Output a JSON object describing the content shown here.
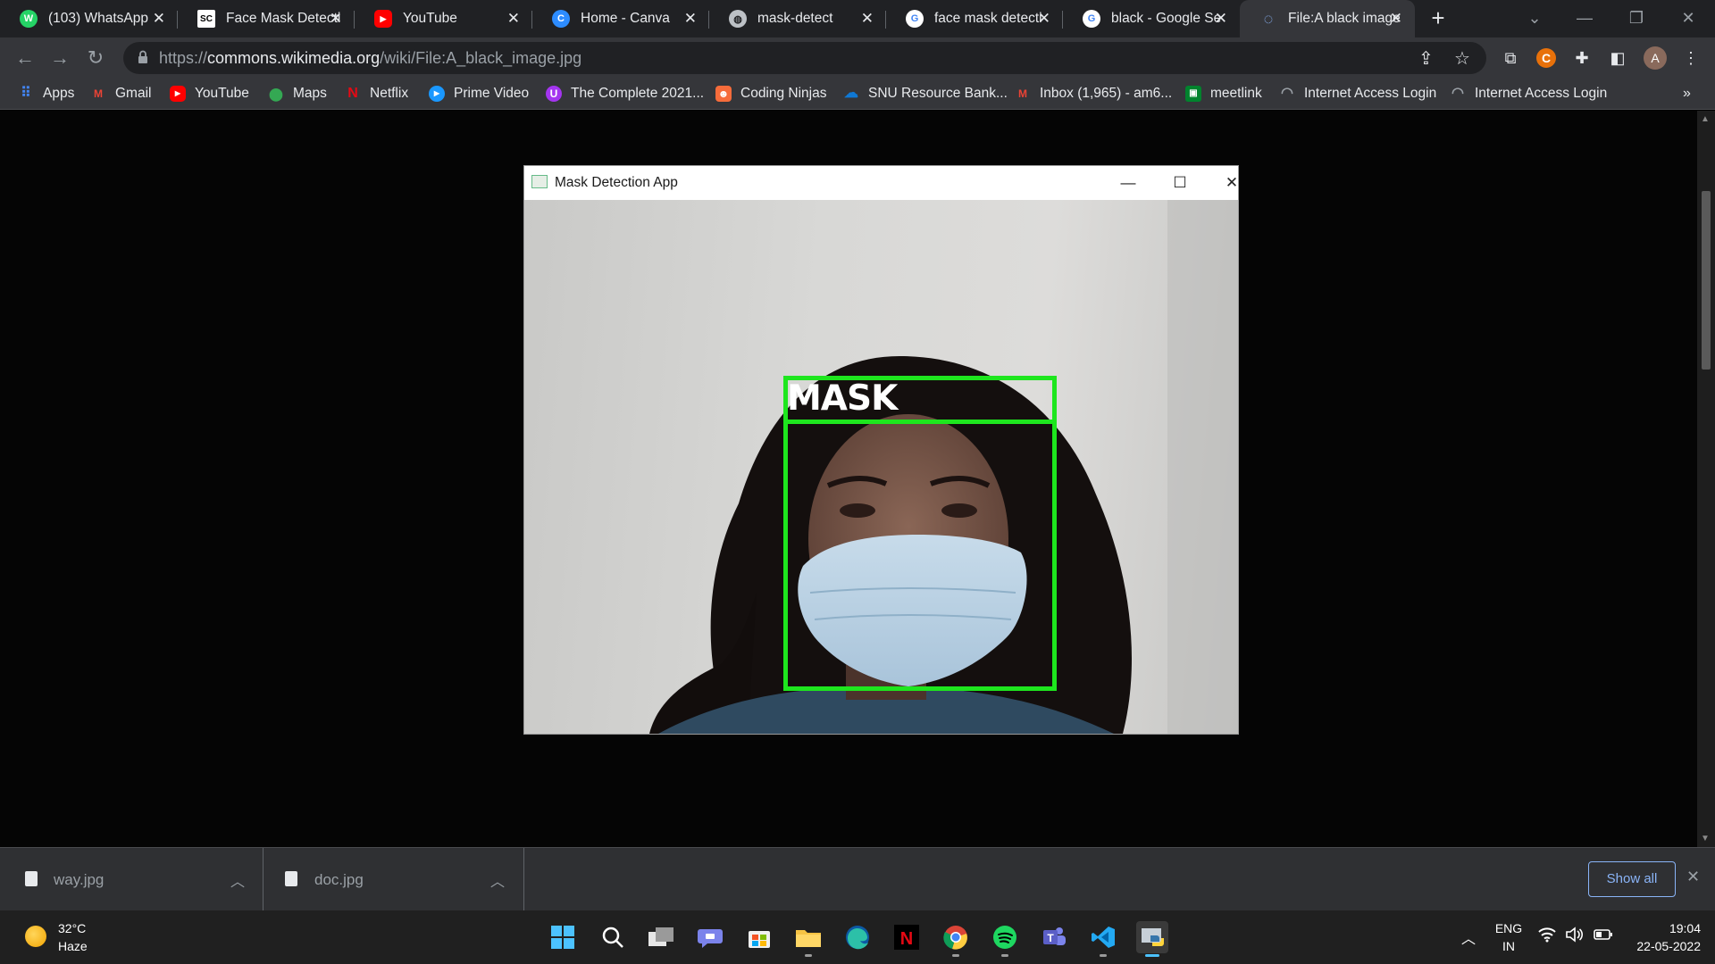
{
  "browser": {
    "tabs": [
      {
        "title": "(103) WhatsApp",
        "icon": "whatsapp-icon",
        "color": "#25d366",
        "glyph": "W"
      },
      {
        "title": "Face Mask Detecti",
        "icon": "sc-icon",
        "color": "#ffffff",
        "glyph": "SC"
      },
      {
        "title": "YouTube",
        "icon": "youtube-icon",
        "color": "#ff0000",
        "glyph": "▶"
      },
      {
        "title": "Home - Canva",
        "icon": "canva-icon",
        "color": "#2d8cff",
        "glyph": "C"
      },
      {
        "title": "mask-detect",
        "icon": "globe-icon",
        "color": "#bdc1c6",
        "glyph": "◍"
      },
      {
        "title": "face mask detecti",
        "icon": "google-icon",
        "color": "#ffffff",
        "glyph": "G"
      },
      {
        "title": "black - Google Se",
        "icon": "google-icon",
        "color": "#ffffff",
        "glyph": "G"
      },
      {
        "title": "File:A black image",
        "icon": "loading-icon",
        "color": "#8ab4f8",
        "glyph": "◌"
      }
    ],
    "url_scheme": "https://",
    "url_host": "commons.wikimedia.org",
    "url_path": "/wiki/File:A_black_image.jpg",
    "avatar_initial": "A",
    "bookmarks": [
      {
        "label": "Apps",
        "icon": "apps-grid-icon",
        "color": "#4285f4",
        "glyph": "⋮"
      },
      {
        "label": "Gmail",
        "icon": "gmail-icon",
        "color": "#ea4335",
        "glyph": "M"
      },
      {
        "label": "YouTube",
        "icon": "youtube-icon",
        "color": "#ff0000",
        "glyph": "▶"
      },
      {
        "label": "Maps",
        "icon": "maps-pin-icon",
        "color": "#34a853",
        "glyph": "⬤"
      },
      {
        "label": "Netflix",
        "icon": "netflix-icon",
        "color": "#e50914",
        "glyph": "N"
      },
      {
        "label": "Prime Video",
        "icon": "prime-video-icon",
        "color": "#1a98ff",
        "glyph": "▶"
      },
      {
        "label": "The Complete 2021...",
        "icon": "udemy-icon",
        "color": "#a435f0",
        "glyph": "U"
      },
      {
        "label": "Coding Ninjas",
        "icon": "coding-ninjas-icon",
        "color": "#f66c3b",
        "glyph": "☻"
      },
      {
        "label": "SNU Resource Bank...",
        "icon": "onedrive-icon",
        "color": "#0f78d4",
        "glyph": "☁"
      },
      {
        "label": "Inbox (1,965) - am6...",
        "icon": "gmail-icon",
        "color": "#ea4335",
        "glyph": "M"
      },
      {
        "label": "meetlink",
        "icon": "meet-icon",
        "color": "#00832d",
        "glyph": "▣"
      },
      {
        "label": "Internet Access Login",
        "icon": "network-icon",
        "color": "#9aa0a6",
        "glyph": "◠"
      },
      {
        "label": "Internet Access Login",
        "icon": "network-icon",
        "color": "#9aa0a6",
        "glyph": "◠"
      }
    ]
  },
  "app": {
    "title": "Mask Detection App",
    "detection_label": "MASK"
  },
  "downloads": [
    {
      "filename": "way.jpg"
    },
    {
      "filename": "doc.jpg"
    }
  ],
  "downloads_show_all": "Show all",
  "taskbar": {
    "temperature": "32°C",
    "weather": "Haze",
    "language": "ENG",
    "region": "IN",
    "time": "19:04",
    "date": "22-05-2022",
    "apps": [
      {
        "name": "start-icon",
        "color": "#4cc2ff"
      },
      {
        "name": "search-icon",
        "color": "#ffffff"
      },
      {
        "name": "task-view-icon",
        "color": "#ffffff"
      },
      {
        "name": "teams-chat-icon",
        "color": "#7b83eb"
      },
      {
        "name": "store-icon",
        "color": "#ffffff"
      },
      {
        "name": "file-explorer-icon",
        "color": "#f6c344"
      },
      {
        "name": "edge-icon",
        "color": "#2cc0a8"
      },
      {
        "name": "netflix-icon",
        "color": "#e50914"
      },
      {
        "name": "chrome-icon",
        "color": "#4285f4"
      },
      {
        "name": "spotify-icon",
        "color": "#1ed760"
      },
      {
        "name": "teams-icon",
        "color": "#5b5fc7"
      },
      {
        "name": "vscode-icon",
        "color": "#23a9f2"
      },
      {
        "name": "python-app-icon",
        "color": "#ffd43b"
      }
    ]
  }
}
